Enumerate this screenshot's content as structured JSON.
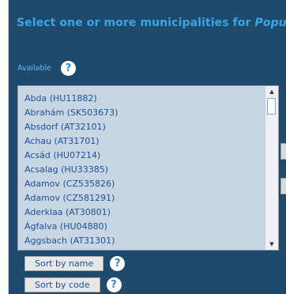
{
  "header": {
    "title_prefix": "Select one or more municipalities for ",
    "title_emphasis": "Populat"
  },
  "available": {
    "label": "Available",
    "help_glyph": "?"
  },
  "municipalities": [
    "Abda (HU11882)",
    "Abrahám (SK503673)",
    "Absdorf (AT32101)",
    "Achau (AT31701)",
    "Acsád (HU07214)",
    "Acsalag (HU33385)",
    "Adamov (CZ535826)",
    "Adamov (CZ581291)",
    "Aderklaa (AT30801)",
    "Ágfalva (HU04880)",
    "Aggsbach (AT31301)"
  ],
  "scrollbar": {
    "up_arrow": "▲",
    "down_arrow": "▼"
  },
  "sort": {
    "by_name_label": "Sort by name",
    "by_code_label": "Sort by code",
    "help_glyph": "?"
  },
  "colors": {
    "panel_bg": "#1f4a6b",
    "title_color": "#3aa6e6",
    "list_bg": "#c8d6e3",
    "list_text": "#1d4f9a"
  }
}
